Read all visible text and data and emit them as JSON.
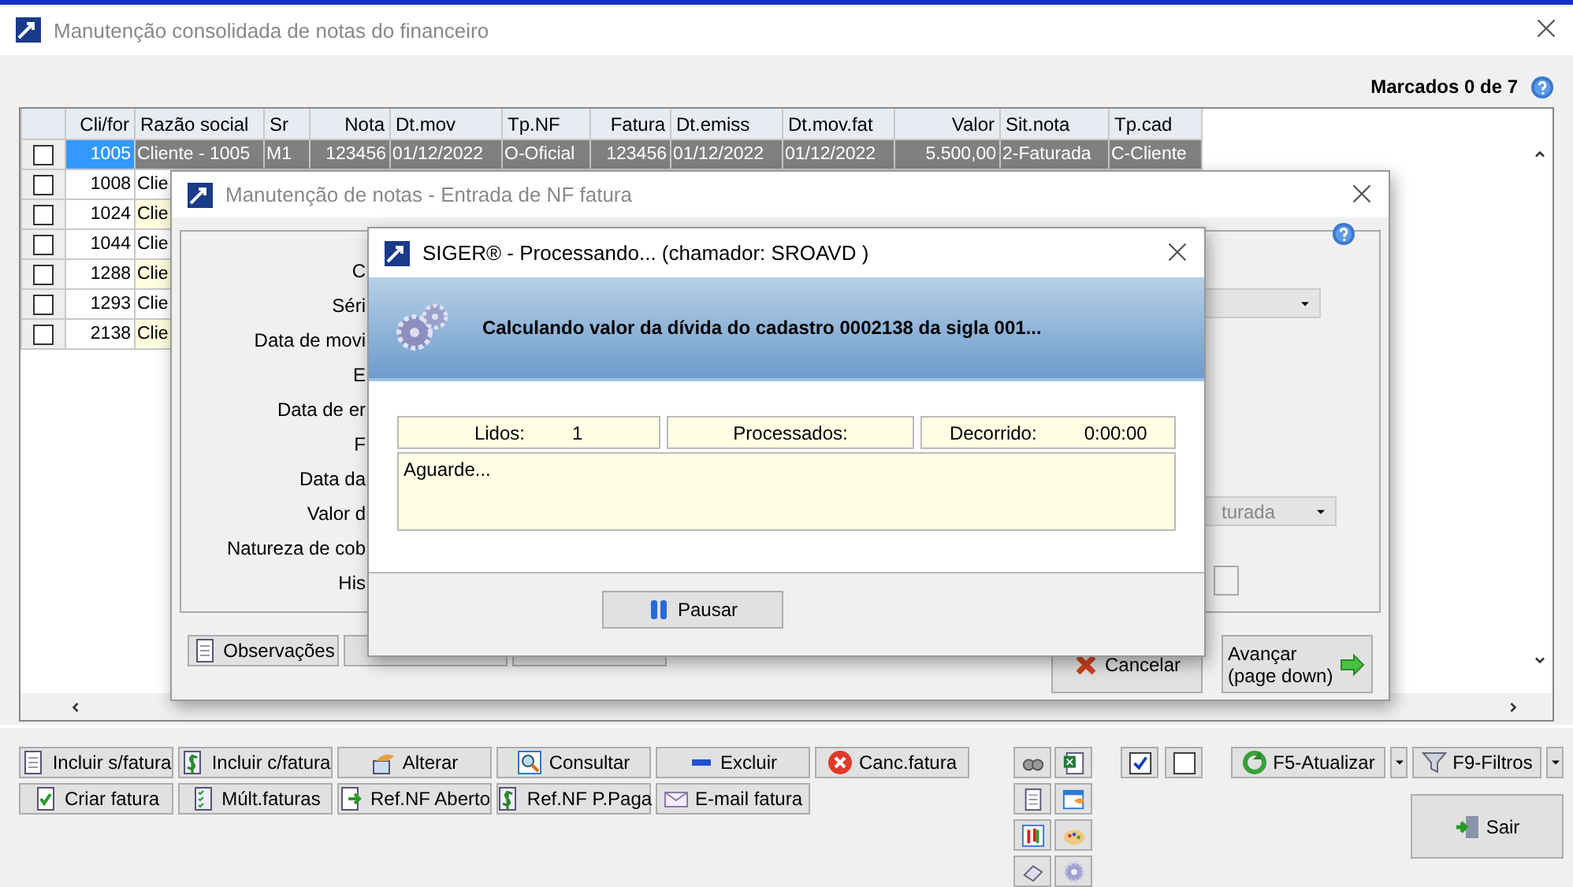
{
  "main_window": {
    "title": "Manutenção consolidada de notas do financeiro",
    "marked_count": "Marcados 0 de 7",
    "table": {
      "columns": [
        "Cli/for",
        "Razão social",
        "Sr",
        "Nota",
        "Dt.mov",
        "Tp.NF",
        "Fatura",
        "Dt.emiss",
        "Dt.mov.fat",
        "Valor",
        "Sit.nota",
        "Tp.cad"
      ],
      "rows": [
        {
          "checked": false,
          "selected": true,
          "cells": [
            "1005",
            "Cliente - 1005",
            "M1",
            "123456",
            "01/12/2022",
            "O-Oficial",
            "123456",
            "01/12/2022",
            "01/12/2022",
            "5.500,00",
            "2-Faturada",
            "C-Cliente"
          ]
        },
        {
          "checked": false,
          "selected": false,
          "cells": [
            "1008",
            "Clie"
          ]
        },
        {
          "checked": false,
          "selected": false,
          "cells": [
            "1024",
            "Clie"
          ]
        },
        {
          "checked": false,
          "selected": false,
          "cells": [
            "1044",
            "Clie"
          ]
        },
        {
          "checked": false,
          "selected": false,
          "cells": [
            "1288",
            "Clie"
          ]
        },
        {
          "checked": false,
          "selected": false,
          "cells": [
            "1293",
            "Clie"
          ]
        },
        {
          "checked": false,
          "selected": false,
          "cells": [
            "2138",
            "Clie"
          ]
        }
      ]
    },
    "action_buttons": [
      [
        "Incluir s/fatura",
        "Incluir c/fatura",
        "Alterar",
        "Consultar",
        "Excluir",
        "Canc.fatura"
      ],
      [
        "Criar fatura",
        "Múlt.faturas",
        "Ref.NF Aberto",
        "Ref.NF P.Paga",
        "E-mail fatura"
      ]
    ],
    "refresh_button": "F5-Atualizar",
    "filter_button": "F9-Filtros",
    "exit_button": "Sair"
  },
  "note_dialog": {
    "title": "Manutenção de notas - Entrada de NF fatura",
    "labels": [
      "C",
      "Séri",
      "Data de movi",
      "E",
      "Data de er",
      "F",
      "Data da",
      "Valor d",
      "Natureza de cob",
      "His"
    ],
    "status_combo": "turada",
    "buttons": [
      "Observações",
      "Cancelar",
      "Avançar\n(page down)"
    ]
  },
  "progress_dialog": {
    "title": "SIGER® - Processando... (chamador: SROAVD )",
    "message": "Calculando valor da dívida do cadastro 0002138 da sigla 001...",
    "counters": [
      {
        "label": "Lidos:",
        "value": "1"
      },
      {
        "label": "Processados:"
      },
      {
        "label": "Decorrido:",
        "value": "0:00:00"
      }
    ],
    "log": "Aguarde...",
    "button": "Pausar"
  }
}
